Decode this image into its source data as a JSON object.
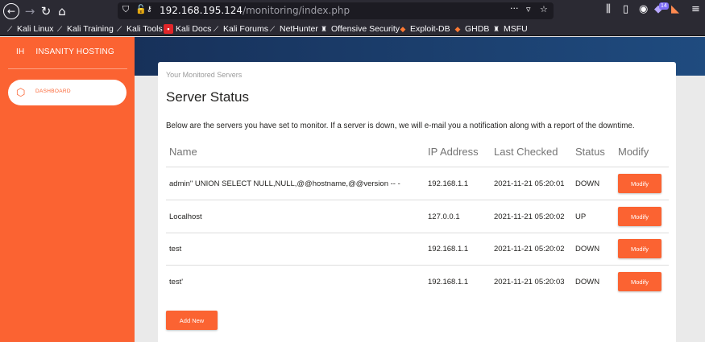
{
  "browser": {
    "url_host": "192.168.195.124",
    "url_path": "/monitoring/index.php",
    "extension_badge": "14",
    "bookmarks": [
      {
        "label": "Kali Linux",
        "icon": "kali-dragon-icon"
      },
      {
        "label": "Kali Training",
        "icon": "kali-dragon-icon"
      },
      {
        "label": "Kali Tools",
        "icon": "kali-dragon-icon"
      },
      {
        "label": "Kali Docs",
        "icon": "kali-docs-icon"
      },
      {
        "label": "Kali Forums",
        "icon": "kali-dragon-icon"
      },
      {
        "label": "NetHunter",
        "icon": "kali-dragon-icon"
      },
      {
        "label": "Offensive Security",
        "icon": "offsec-icon"
      },
      {
        "label": "Exploit-DB",
        "icon": "exploit-db-icon"
      },
      {
        "label": "GHDB",
        "icon": "ghdb-icon"
      },
      {
        "label": "MSFU",
        "icon": "offsec-icon"
      }
    ]
  },
  "sidebar": {
    "brand_short": "IH",
    "brand_name": "INSANITY HOSTING",
    "nav_dashboard": "DASHBOARD"
  },
  "card": {
    "category": "Your Monitored Servers",
    "title": "Server Status",
    "description": "Below are the servers you have set to monitor. If a server is down, we will e-mail you a notification along with a report of the downtime."
  },
  "table": {
    "headers": [
      "Name",
      "IP Address",
      "Last Checked",
      "Status",
      "Modify"
    ],
    "rows": [
      {
        "name": "admin\" UNION SELECT NULL,NULL,@@hostname,@@version -- -",
        "ip": "192.168.1.1",
        "checked": "2021-11-21 05:20:01",
        "status": "DOWN",
        "action": "Modify"
      },
      {
        "name": "Localhost",
        "ip": "127.0.0.1",
        "checked": "2021-11-21 05:20:02",
        "status": "UP",
        "action": "Modify"
      },
      {
        "name": "test",
        "ip": "192.168.1.1",
        "checked": "2021-11-21 05:20:02",
        "status": "DOWN",
        "action": "Modify"
      },
      {
        "name": "test'",
        "ip": "192.168.1.1",
        "checked": "2021-11-21 05:20:03",
        "status": "DOWN",
        "action": "Modify"
      }
    ]
  },
  "add_button": "Add New",
  "colors": {
    "accent": "#fb6332",
    "header_band": "#1f4b7f",
    "browser_chrome": "#2b2a33"
  }
}
